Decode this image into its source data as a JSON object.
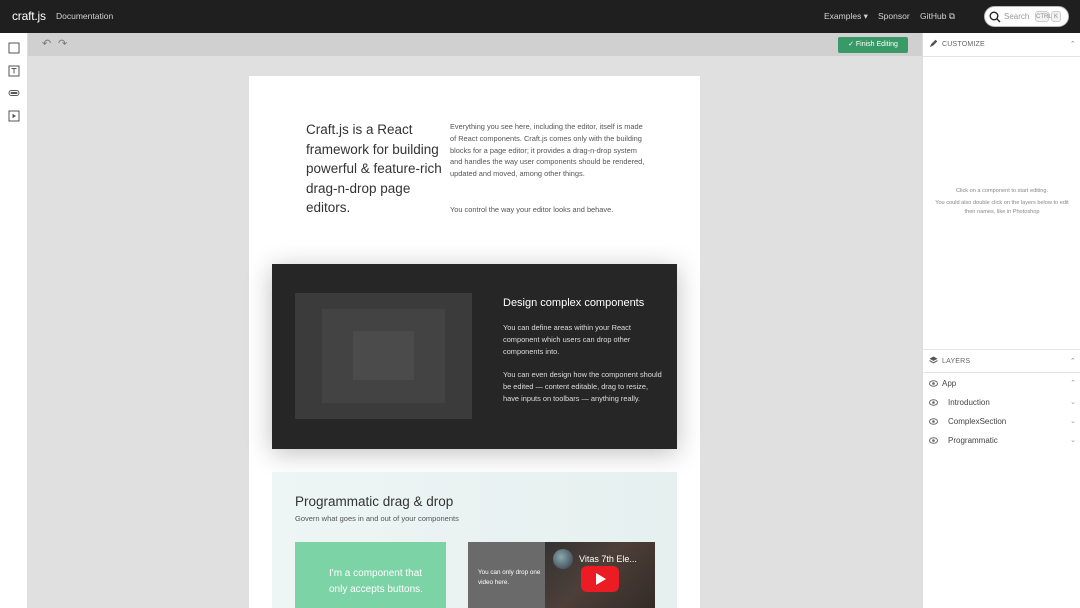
{
  "topbar": {
    "brand": "craft.js",
    "documentation": "Documentation",
    "examples": "Examples ▾",
    "sponsor": "Sponsor",
    "github": "GitHub ⧉",
    "search_placeholder": "Search",
    "kbd_ctrl": "CTRL",
    "kbd_k": "K"
  },
  "toolbox": {
    "icons": [
      "container-icon",
      "text-icon",
      "button-icon",
      "video-icon"
    ]
  },
  "canvas": {
    "undo": "↶",
    "redo": "↷",
    "finish_label": "✓ Finish Editing",
    "intro": {
      "heading": "Craft.js is a React framework for building powerful & feature-rich drag-n-drop page editors.",
      "paragraph1": "Everything you see here, including the editor, itself is made of React components. Craft.js comes only with the building blocks for a page editor; it provides a drag-n-drop system and handles the way user components should be rendered, updated and moved, among other things.",
      "paragraph2": "You control the way your editor looks and behave."
    },
    "complex": {
      "heading": "Design complex components",
      "paragraph1": "You can define areas within your React component which users can drop other components into.",
      "paragraph2": "You can even design how the component should be edited — content editable, drag to resize, have inputs on toolbars — anything really."
    },
    "programmatic": {
      "heading": "Programmatic drag & drop",
      "subheading": "Govern what goes in and out of your components",
      "green_text": "I'm a component that only accepts buttons.",
      "video_label": "You can only drop one video here.",
      "video_title": "Vitas 7th Ele..."
    }
  },
  "customize": {
    "title": "CUSTOMIZE",
    "msg1": "Click on a component to start editing.",
    "msg2": "You could also double click on the layers below to edit their names, like in Photoshop"
  },
  "layers": {
    "title": "LAYERS",
    "items": [
      {
        "name": "App"
      },
      {
        "name": "Introduction"
      },
      {
        "name": "ComplexSection"
      },
      {
        "name": "Programmatic"
      }
    ]
  },
  "colors": {
    "topbar": "#1f1f1f",
    "finish": "#3a9a67",
    "green_component": "#7cd3a6",
    "dark_section": "#262626"
  }
}
